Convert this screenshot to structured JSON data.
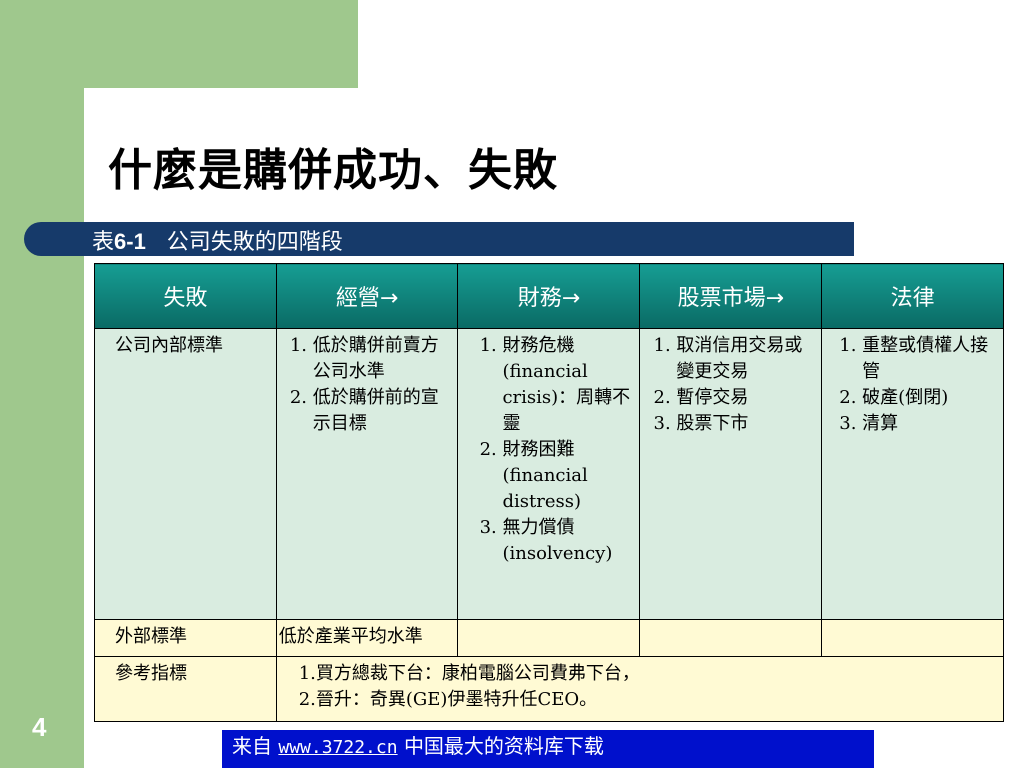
{
  "slide": {
    "title": "什麼是購併成功、失敗",
    "page_number": "4"
  },
  "table_caption": {
    "prefix": "表",
    "number": "6-1",
    "text": "公司失敗的四階段"
  },
  "table": {
    "headers": [
      "失敗",
      "經營→",
      "財務→",
      "股票市場→",
      "法律"
    ],
    "row_internal": {
      "label": "公司內部標準",
      "management": [
        "低於購併前賣方公司水準",
        "低於購併前的宣示目標"
      ],
      "finance": [
        "財務危機(financial crisis)：周轉不靈",
        "財務困難(financial distress)",
        "無力償債(insolvency)"
      ],
      "stock_market": [
        "取消信用交易或變更交易",
        "暫停交易",
        "股票下市"
      ],
      "legal": [
        "重整或債權人接管",
        "破產(倒閉)",
        "清算"
      ]
    },
    "row_external": {
      "label": "外部標準",
      "management": "低於產業平均水準"
    },
    "row_reference": {
      "label": "參考指標",
      "line1": "1.買方總裁下台：康柏電腦公司費弗下台，",
      "line2": "2.晉升：奇異(GE)伊墨特升任CEO。"
    }
  },
  "footer": {
    "prefix": "来自",
    "link": "www.3722.cn",
    "suffix": "中国最大的资料库下载"
  }
}
